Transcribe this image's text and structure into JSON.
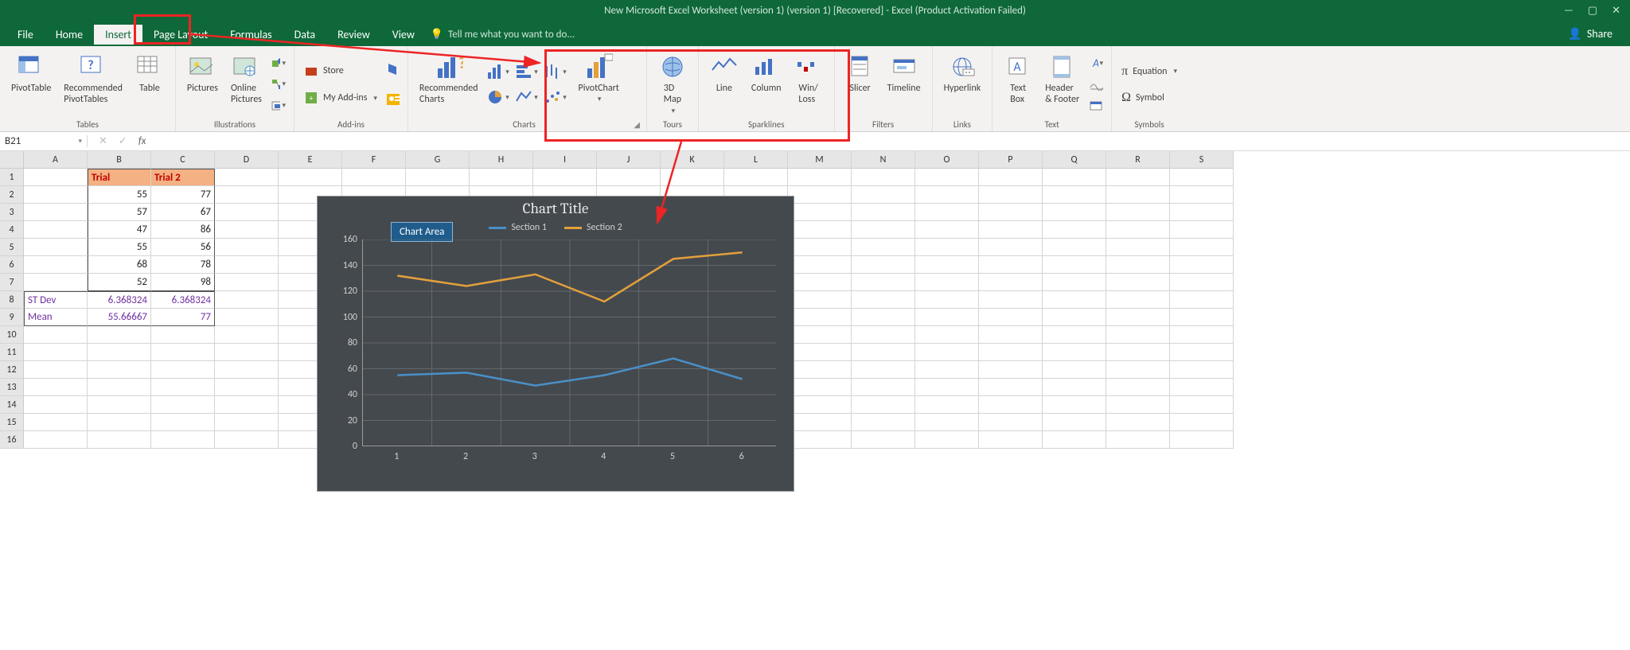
{
  "titlebar": {
    "text": "New Microsoft Excel Worksheet (version 1) (version 1) [Recovered] - Excel (Product Activation Failed)"
  },
  "menubar": {
    "items": [
      "File",
      "Home",
      "Insert",
      "Page Layout",
      "Formulas",
      "Data",
      "Review",
      "View"
    ],
    "active_index": 2,
    "tell_me": "Tell me what you want to do...",
    "share": "Share"
  },
  "ribbon": {
    "groups": {
      "tables": {
        "label": "Tables",
        "pivot": "PivotTable",
        "recpivot": "Recommended\nPivotTables",
        "table": "Table"
      },
      "illustrations": {
        "label": "Illustrations",
        "pictures": "Pictures",
        "online": "Online\nPictures"
      },
      "addins": {
        "label": "Add-ins",
        "store": "Store",
        "myaddins": "My Add-ins"
      },
      "charts": {
        "label": "Charts",
        "rec": "Recommended\nCharts",
        "pivotchart": "PivotChart"
      },
      "tours": {
        "label": "Tours",
        "map": "3D\nMap"
      },
      "sparklines": {
        "label": "Sparklines",
        "line": "Line",
        "column": "Column",
        "winloss": "Win/\nLoss"
      },
      "filters": {
        "label": "Filters",
        "slicer": "Slicer",
        "timeline": "Timeline"
      },
      "links": {
        "label": "Links",
        "hyperlink": "Hyperlink"
      },
      "text": {
        "label": "Text",
        "textbox": "Text\nBox",
        "header": "Header\n& Footer"
      },
      "symbols": {
        "label": "Symbols",
        "equation": "Equation",
        "symbol": "Symbol"
      }
    }
  },
  "namebox": {
    "cell": "B21",
    "fx": "fx"
  },
  "columns": [
    "A",
    "B",
    "C",
    "D",
    "E",
    "F",
    "G",
    "H",
    "I",
    "J",
    "K",
    "L",
    "M",
    "N",
    "O",
    "P",
    "Q",
    "R",
    "S"
  ],
  "rows_count": 16,
  "table": {
    "headers": [
      "Trial",
      "Trial 2"
    ],
    "rows": [
      [
        55,
        77
      ],
      [
        57,
        67
      ],
      [
        47,
        86
      ],
      [
        55,
        56
      ],
      [
        68,
        78
      ],
      [
        52,
        98
      ]
    ],
    "stdev_label": "ST Dev",
    "stdev": [
      "6.368324",
      "6.368324"
    ],
    "mean_label": "Mean",
    "mean": [
      "55.66667",
      "77"
    ]
  },
  "chart_data": {
    "type": "line",
    "title": "Chart Title",
    "chart_area_label": "Chart Area",
    "x": [
      1,
      2,
      3,
      4,
      5,
      6
    ],
    "series": [
      {
        "name": "Section 1",
        "color": "#4a90c7",
        "values": [
          55,
          57,
          47,
          55,
          68,
          52
        ]
      },
      {
        "name": "Section 2",
        "color": "#e3a03b",
        "values": [
          132,
          124,
          133,
          112,
          145,
          150
        ]
      }
    ],
    "ylim": [
      0,
      160
    ],
    "ytick": [
      0,
      20,
      40,
      60,
      80,
      100,
      120,
      140,
      160
    ],
    "xlabel": "",
    "ylabel": ""
  }
}
